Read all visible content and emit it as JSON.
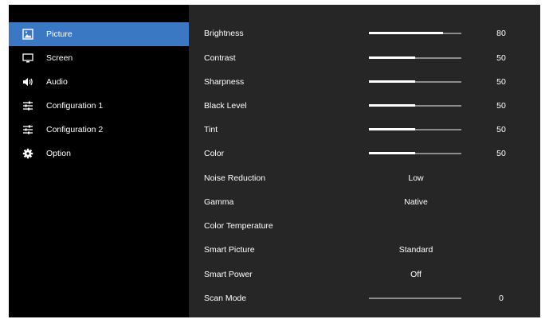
{
  "menu": {
    "items": [
      {
        "label": "Picture",
        "icon": "picture-icon",
        "selected": true
      },
      {
        "label": "Screen",
        "icon": "monitor-icon",
        "selected": false
      },
      {
        "label": "Audio",
        "icon": "speaker-icon",
        "selected": false
      },
      {
        "label": "Configuration 1",
        "icon": "sliders-icon",
        "selected": false
      },
      {
        "label": "Configuration 2",
        "icon": "sliders-icon",
        "selected": false
      },
      {
        "label": "Option",
        "icon": "gear-icon",
        "selected": false
      }
    ]
  },
  "settings": [
    {
      "label": "Brightness",
      "type": "slider",
      "value": "80",
      "level": 80
    },
    {
      "label": "Contrast",
      "type": "slider",
      "value": "50",
      "level": 50
    },
    {
      "label": "Sharpness",
      "type": "slider",
      "value": "50",
      "level": 50
    },
    {
      "label": "Black Level",
      "type": "slider",
      "value": "50",
      "level": 50
    },
    {
      "label": "Tint",
      "type": "slider",
      "value": "50",
      "level": 50
    },
    {
      "label": "Color",
      "type": "slider",
      "value": "50",
      "level": 50
    },
    {
      "label": "Noise Reduction",
      "type": "option",
      "value": "Low"
    },
    {
      "label": "Gamma",
      "type": "option",
      "value": "Native"
    },
    {
      "label": "Color Temperature",
      "type": "option",
      "value": ""
    },
    {
      "label": "Smart Picture",
      "type": "option",
      "value": "Standard"
    },
    {
      "label": "Smart Power",
      "type": "option",
      "value": "Off"
    },
    {
      "label": "Scan Mode",
      "type": "slider",
      "value": "0",
      "level": 0
    }
  ],
  "colors": {
    "selected": "#3a78c3",
    "panel": "#262626",
    "track": "#8c8c8c",
    "fill": "#ffffff"
  }
}
